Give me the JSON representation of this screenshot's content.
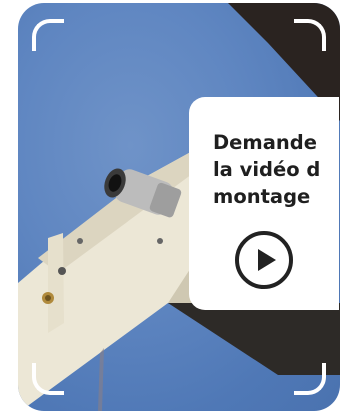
{
  "cta": {
    "lines": [
      "Demande",
      "la vidéo d",
      "montage"
    ]
  },
  "icons": {
    "play": "play-icon",
    "frame": "viewfinder-corner-icon"
  },
  "colors": {
    "sky": "#5f86c1",
    "panel": "#ffffff",
    "text": "#1f1f1f",
    "bracket": "#ffffff"
  }
}
